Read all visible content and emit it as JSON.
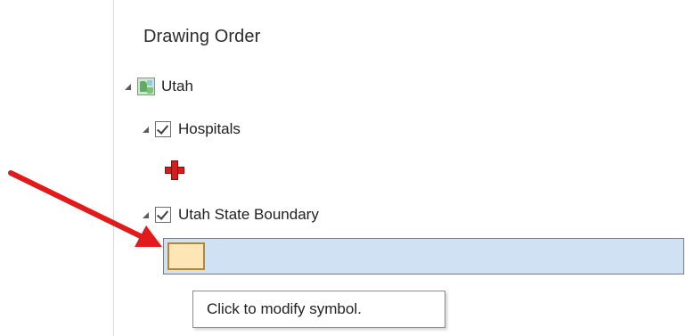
{
  "panel": {
    "title": "Drawing Order"
  },
  "tree": {
    "map": {
      "label": "Utah",
      "icon": "map-icon"
    },
    "layers": [
      {
        "label": "Hospitals",
        "checked": true,
        "symbol": "red-cross-icon"
      },
      {
        "label": "Utah State Boundary",
        "checked": true,
        "symbol": "polygon-swatch",
        "symbol_fill": "#fde5b5",
        "symbol_outline": "#a8893f"
      }
    ]
  },
  "tooltip": {
    "text": "Click to modify symbol."
  },
  "colors": {
    "selection_fill": "#cfe1f3",
    "selection_border": "#3d8ad6",
    "annotation_arrow": "#e11b1b",
    "hospital_cross": "#d61d1d"
  }
}
